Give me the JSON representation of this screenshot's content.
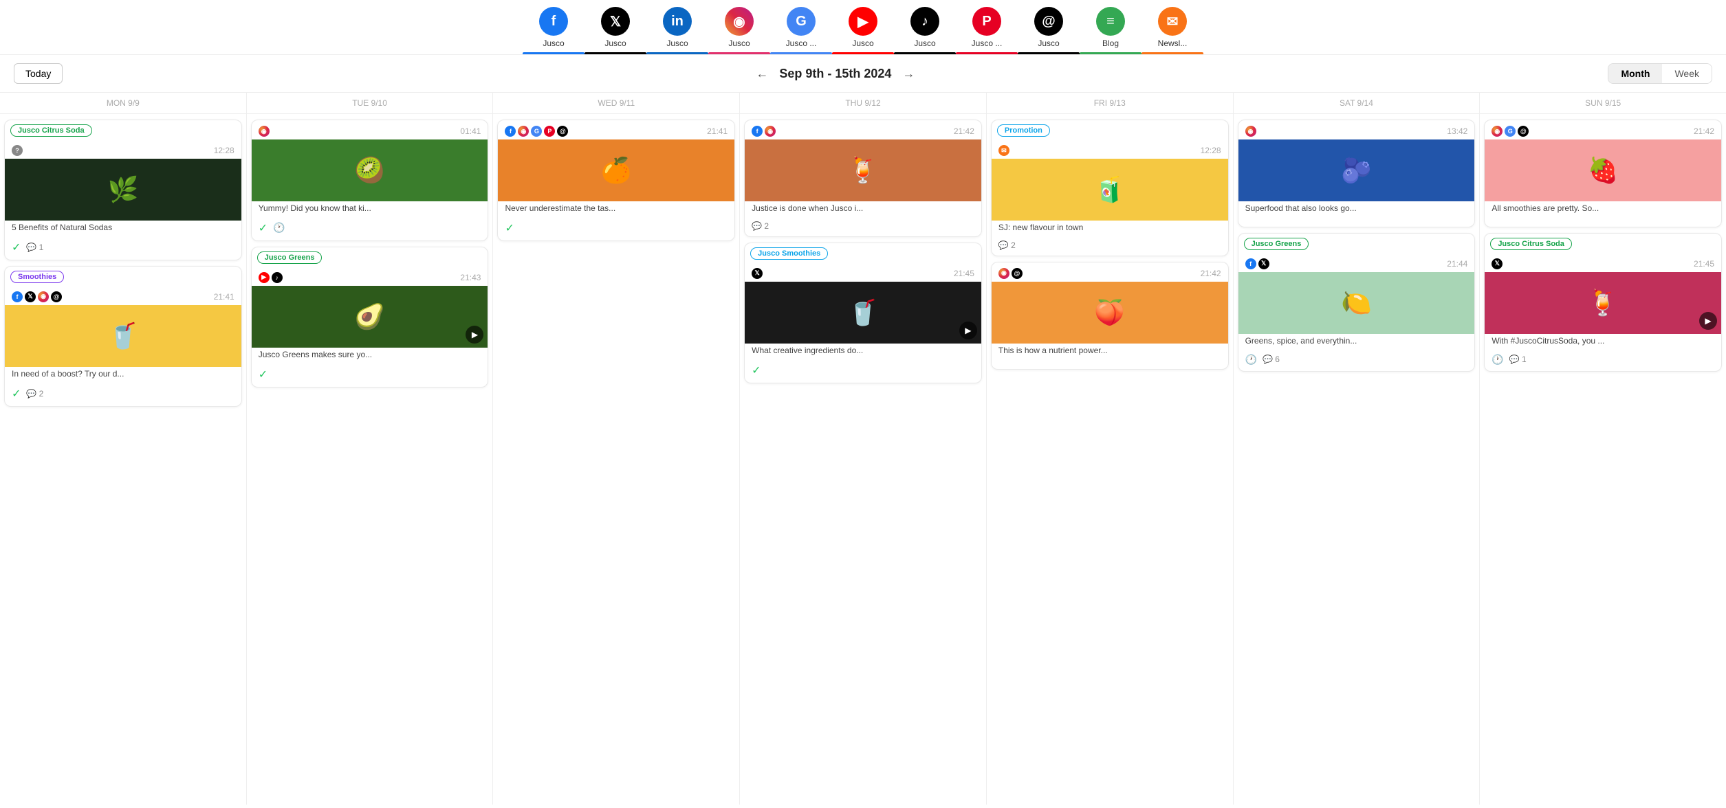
{
  "channels": [
    {
      "id": "facebook",
      "label": "Jusco",
      "color": "#1877f2",
      "icon": "f",
      "underline": "#1877f2",
      "symbol": "𝐟"
    },
    {
      "id": "twitter",
      "label": "Jusco",
      "color": "#000",
      "icon": "𝕏",
      "underline": "#000",
      "symbol": "𝕏"
    },
    {
      "id": "linkedin",
      "label": "Jusco",
      "color": "#0a66c2",
      "icon": "in",
      "underline": "#0a66c2",
      "symbol": "in"
    },
    {
      "id": "instagram",
      "label": "Jusco",
      "color": "#e1306c",
      "icon": "📷",
      "underline": "#e1306c",
      "symbol": "◉"
    },
    {
      "id": "google",
      "label": "Jusco ...",
      "color": "#4285f4",
      "icon": "G",
      "underline": "#4285f4",
      "symbol": "G"
    },
    {
      "id": "youtube",
      "label": "Jusco",
      "color": "#ff0000",
      "icon": "▶",
      "underline": "#ff0000",
      "symbol": "▶"
    },
    {
      "id": "tiktok",
      "label": "Jusco",
      "color": "#000",
      "icon": "♪",
      "underline": "#000",
      "symbol": "♪"
    },
    {
      "id": "pinterest",
      "label": "Jusco ...",
      "color": "#e60023",
      "icon": "P",
      "underline": "#e60023",
      "symbol": "P"
    },
    {
      "id": "threads",
      "label": "Jusco",
      "color": "#000",
      "icon": "@",
      "underline": "#000",
      "symbol": "@"
    },
    {
      "id": "blog",
      "label": "Blog",
      "color": "#34a853",
      "icon": "B",
      "underline": "#34a853",
      "symbol": "≡"
    },
    {
      "id": "newsletter",
      "label": "Newsl...",
      "color": "#f97316",
      "icon": "✉",
      "underline": "#f97316",
      "symbol": "✉"
    }
  ],
  "nav": {
    "today_label": "Today",
    "date_range": "Sep 9th - 15th 2024",
    "month_label": "Month",
    "week_label": "Week"
  },
  "days": [
    {
      "label": "MON 9/9",
      "short": "MON 9/9"
    },
    {
      "label": "TUE 9/10",
      "short": "TUE 9/10"
    },
    {
      "label": "WED 9/11",
      "short": "WED 9/11"
    },
    {
      "label": "THU 9/12",
      "short": "THU 9/12"
    },
    {
      "label": "FRI 9/13",
      "short": "FRI 9/13"
    },
    {
      "label": "SAT 9/14",
      "short": "SAT 9/14"
    },
    {
      "label": "SUN 9/15",
      "short": "SUN 9/15"
    }
  ],
  "cards": {
    "mon": [
      {
        "tag": "Jusco Citrus Soda",
        "tag_class": "tag-citrus",
        "channels": [
          "blog"
        ],
        "time": "12:28",
        "img_color": "#1a2e1a",
        "img_text": "🌿",
        "title": "5 Benefits of Natural Sodas",
        "has_check": true,
        "comments": 1,
        "has_clock": false
      },
      {
        "tag": "Smoothies",
        "tag_class": "tag-smoothies",
        "channels": [
          "fb",
          "tw",
          "ig",
          "th"
        ],
        "time": "21:41",
        "img_color": "#f5c842",
        "img_text": "🥤",
        "title": "In need of a boost? Try our d...",
        "has_check": true,
        "comments": 2,
        "has_clock": false
      }
    ],
    "tue": [
      {
        "tag": null,
        "channels": [
          "ig"
        ],
        "time": "01:41",
        "img_color": "#3a7d2c",
        "img_text": "🥝",
        "title": "Yummy! Did you know that ki...",
        "has_check": true,
        "has_clock": true,
        "comments": 0
      },
      {
        "tag": "Jusco Greens",
        "tag_class": "tag-greens",
        "channels": [
          "yt",
          "tk"
        ],
        "time": "21:43",
        "img_color": "#2d5a1b",
        "img_text": "🥑",
        "title": "Jusco Greens makes sure yo...",
        "has_check": true,
        "has_clock": false,
        "comments": 0,
        "has_video": true
      }
    ],
    "wed": [
      {
        "tag": null,
        "channels": [
          "fb",
          "ig",
          "gg",
          "pi",
          "th"
        ],
        "time": "21:41",
        "img_color": "#e8822a",
        "img_text": "🍊",
        "title": "Never underestimate the tas...",
        "has_check": true,
        "has_clock": false,
        "comments": 0
      }
    ],
    "thu": [
      {
        "tag": null,
        "channels": [
          "fb",
          "ig"
        ],
        "time": "21:42",
        "img_color": "#c97040",
        "img_text": "🍹",
        "title": "Justice is done when Jusco i...",
        "has_check": false,
        "has_clock": false,
        "comments": 2
      },
      {
        "tag": "Jusco Smoothies",
        "tag_class": "tag-smoothies2",
        "channels": [
          "tw"
        ],
        "time": "21:45",
        "img_color": "#1a1a1a",
        "img_text": "🥤",
        "title": "What creative ingredients do...",
        "has_check": true,
        "has_clock": false,
        "comments": 0,
        "has_video": true
      }
    ],
    "fri": [
      {
        "tag": "Promotion",
        "tag_class": "tag-promo",
        "channels": [
          "nl"
        ],
        "time": "12:28",
        "img_color": "#f5c842",
        "img_text": "🧃",
        "title": "SJ: new flavour in town",
        "has_check": false,
        "has_clock": false,
        "comments": 2
      },
      {
        "tag": null,
        "channels": [
          "ig",
          "th"
        ],
        "time": "21:42",
        "img_color": "#f0973a",
        "img_text": "🍑",
        "title": "This is how a nutrient power...",
        "has_check": false,
        "has_clock": false,
        "comments": 0
      }
    ],
    "sat": [
      {
        "tag": null,
        "channels": [
          "ig"
        ],
        "time": "13:42",
        "img_color": "#2255aa",
        "img_text": "🫐",
        "title": "Superfood that also looks go...",
        "has_check": false,
        "has_clock": false,
        "comments": 0
      },
      {
        "tag": "Jusco Greens",
        "tag_class": "tag-greens",
        "channels": [
          "fb",
          "tw"
        ],
        "time": "21:44",
        "img_color": "#a8d5b5",
        "img_text": "🍋",
        "title": "Greens, spice, and everythin...",
        "has_check": false,
        "has_clock": true,
        "comments": 6
      }
    ],
    "sun": [
      {
        "tag": null,
        "channels": [
          "ig",
          "gg",
          "th"
        ],
        "time": "21:42",
        "img_color": "#f5a0a0",
        "img_text": "🍓",
        "title": "All smoothies are pretty. So...",
        "has_check": false,
        "has_clock": false,
        "comments": 0
      },
      {
        "tag": "Jusco Citrus Soda",
        "tag_class": "tag-citrus",
        "channels": [
          "tw"
        ],
        "time": "21:45",
        "img_color": "#c0305a",
        "img_text": "🍹",
        "title": "With #JuscoCitrusSoda, you ...",
        "has_check": false,
        "has_clock": true,
        "comments": 1,
        "has_video": true
      }
    ]
  }
}
